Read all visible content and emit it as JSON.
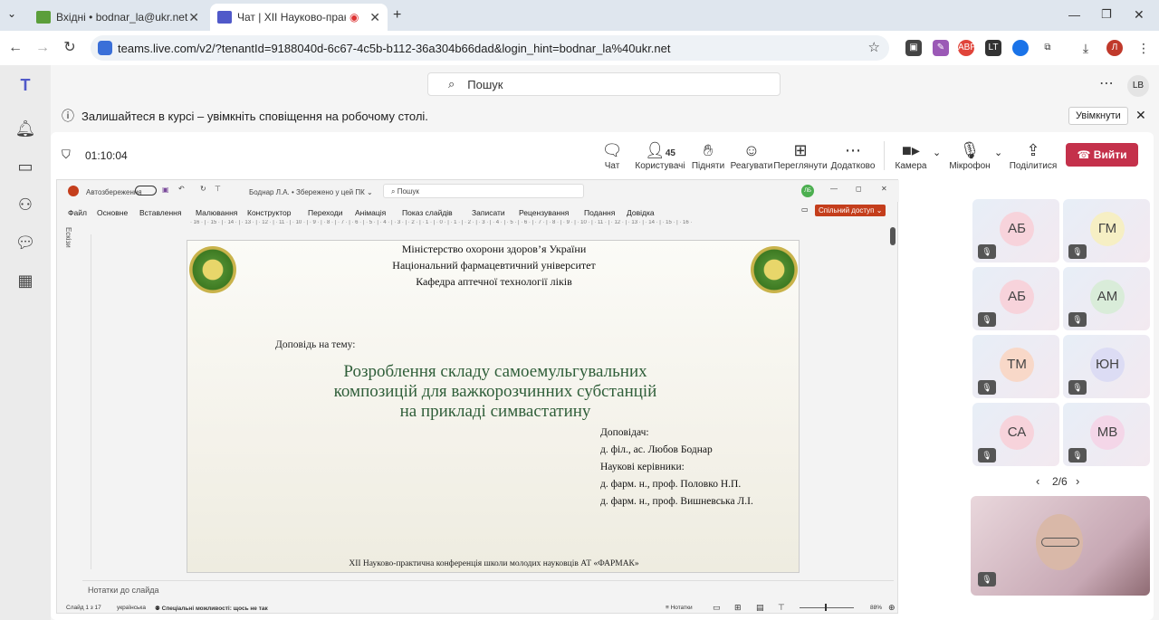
{
  "browser": {
    "tabs": [
      {
        "title": "Вхідні • bodnar_la@ukr.net"
      },
      {
        "title": "Чат | XII Науково-практич"
      }
    ],
    "new_tab": "+",
    "url": "teams.live.com/v2/?tenantId=9188040d-6c67-4c5b-b112-36a304b66dad&login_hint=bodnar_la%40ukr.net",
    "profile_initial": "Л"
  },
  "teams": {
    "search_placeholder": "Пошук",
    "user_initials": "LB",
    "notice": "Залишайтеся в курсі – увімкніть сповіщення на робочому столі.",
    "notice_button": "Увімкнути",
    "timer": "01:10:04",
    "toolbar": {
      "chat": "Чат",
      "people_count": "45",
      "people": "Користувачі",
      "raise": "Підняти",
      "react": "Реагувати",
      "view": "Переглянути",
      "more": "Додатково",
      "camera": "Камера",
      "mic": "Мікрофон",
      "share": "Поділитися",
      "leave": "Вийти"
    },
    "participants": [
      {
        "initials": "АБ",
        "color": "#f7d3db"
      },
      {
        "initials": "ГМ",
        "color": "#f6efc4"
      },
      {
        "initials": "АБ",
        "color": "#f7d3db"
      },
      {
        "initials": "АМ",
        "color": "#d9ecd9"
      },
      {
        "initials": "ТМ",
        "color": "#f8d8c8"
      },
      {
        "initials": "ЮН",
        "color": "#dcdcf4"
      },
      {
        "initials": "СА",
        "color": "#f7d3db"
      },
      {
        "initials": "МВ",
        "color": "#f4d6e8"
      }
    ],
    "pager": "2/6"
  },
  "ppt": {
    "autosave": "Автозбереження",
    "doc_title": "Боднар Л.А. • Збережено у цей ПК ⌄",
    "search": "Пошук",
    "user": "ЛБ",
    "menu": [
      "Файл",
      "Основне",
      "Вставлення",
      "Малювання",
      "Конструктор",
      "Переходи",
      "Анімація",
      "Показ слайдів",
      "Записати",
      "Рецензування",
      "Подання",
      "Довідка"
    ],
    "share": "Спільний доступ",
    "sketches": "Ескізи",
    "notes_placeholder": "Нотатки до слайда",
    "status_slide": "Слайд 1 з 17",
    "status_lang": "українська",
    "status_access": "Спеціальні можливості: щось не так",
    "status_notes": "Нотатки",
    "zoom": "88%",
    "ruler": "· 16 · | · 15 · | · 14 · | · 13 · | · 12 · | · 11 · | · 10 · | · 9 · | · 8 · | · 7 · | · 6 · | · 5 · | · 4 · | · 3 · | · 2 · | · 1 · | · 0 · | · 1 · | · 2 · | · 3 · | · 4 · | · 5 · | · 6 · | · 7 · | · 8 · | · 9 · | · 10 · | · 11 · | · 12 · | · 13 · | · 14 · | · 15 · | · 16 ·",
    "slide": {
      "line1": "Міністерство охорони здоров’я України",
      "line2": "Національний фармацевтичний університет",
      "line3": "Кафедра аптечної технології ліків",
      "report": "Доповідь на тему:",
      "title1": "Розроблення складу самоемульгувальних",
      "title2": "композицій для важкорозчинних субстанцій",
      "title3": "на прикладі симвастатину",
      "r1": "Доповідач:",
      "r2": "д. філ., ас. Любов Боднар",
      "r3": "Наукові керівники:",
      "r4": "д. фарм. н., проф. Половко Н.П.",
      "r5": "д. фарм. н., проф. Вишневська Л.І.",
      "footer": "XII Науково-практична конференція школи молодих науковців АТ «ФАРМАК»"
    }
  }
}
